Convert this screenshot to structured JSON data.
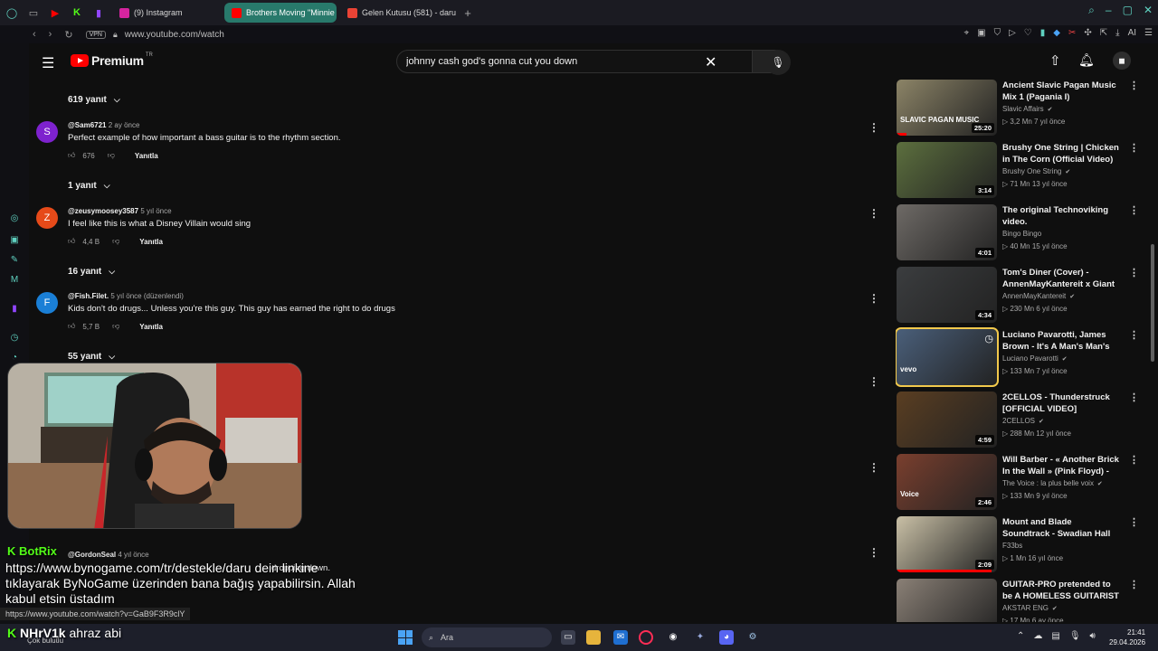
{
  "browser": {
    "tabs": [
      {
        "label": "(9) Instagram",
        "color": "#d6249f"
      },
      {
        "label": "Brothers Moving \"Minnie",
        "color": "#ff0000"
      },
      {
        "label": "Gelen Kutusu (581) - daru",
        "color": "#ea4335"
      }
    ],
    "new_tab": "+",
    "vpn": "VPN",
    "url": "www.youtube.com/watch",
    "accent": "#28796b"
  },
  "youtube": {
    "logo_text": "Premium",
    "logo_region": "TR",
    "search_value": "johnny cash god's gonna cut you down"
  },
  "comments": {
    "toggles": [
      {
        "label": "619 yanıt"
      },
      {
        "label": "1 yanıt"
      },
      {
        "label": "16 yanıt"
      },
      {
        "label": "55 yanıt"
      }
    ],
    "items": [
      {
        "initial": "S",
        "avatar_color": "#7e22ce",
        "author": "@Sam6721",
        "time": "2 ay önce",
        "text": "Perfect example of how important a bass guitar is to the rhythm section.",
        "likes": "676",
        "reply": "Yanıtla"
      },
      {
        "initial": "Z",
        "avatar_color": "#e64a19",
        "author": "@zeusymoosey3587",
        "time": "5 yıl önce",
        "text": "I feel like this is what a Disney Villain would sing",
        "likes": "4,4 B",
        "reply": "Yanıtla"
      },
      {
        "initial": "F",
        "avatar_color": "#1a7fd6",
        "author": "@Fish.Filet.",
        "time": "5 yıl önce (düzenlendi)",
        "text": "Kids don't do drugs... Unless you're this guy. This guy has earned the right to do drugs",
        "likes": "5,7 B",
        "reply": "Yanıtla"
      }
    ],
    "gordon_author": "@GordonSeal",
    "gordon_time": "4 yıl önce",
    "gordon_text_tail": "dropping down."
  },
  "sidebar": {
    "videos": [
      {
        "title": "Ancient Slavic Pagan Music Mix 1 (Pagania I)",
        "channel": "Slavic Affairs",
        "verified": true,
        "meta": "▷ 3,2 Mn   7 yıl önce",
        "duration": "25:20",
        "thumb_color": "#8c8467",
        "thumb_text": "SLAVIC PAGAN MUSIC",
        "progress": 0.1
      },
      {
        "title": "Brushy One String | Chicken in The Corn (Official Video)",
        "channel": "Brushy One String",
        "verified": true,
        "meta": "▷ 71 Mn   13 yıl önce",
        "duration": "3:14",
        "thumb_color": "#5c6f3e",
        "thumb_text": "",
        "progress": 0
      },
      {
        "title": "The original Technoviking video.",
        "channel": "Bingo Bingo",
        "verified": false,
        "meta": "▷ 40 Mn   15 yıl önce",
        "duration": "4:01",
        "thumb_color": "#6e6a66",
        "thumb_text": "",
        "progress": 0
      },
      {
        "title": "Tom's Diner (Cover) - AnnenMayKantereit x Giant ...",
        "channel": "AnnenMayKantereit",
        "verified": true,
        "meta": "▷ 230 Mn   6 yıl önce",
        "duration": "4:34",
        "thumb_color": "#3b3d3f",
        "thumb_text": "",
        "progress": 0
      },
      {
        "title": "Luciano Pavarotti, James Brown - It's A Man's Man's Man's Worl...",
        "channel": "Luciano Pavarotti",
        "verified": true,
        "meta": "▷ 133 Mn   7 yıl önce",
        "duration": "",
        "thumb_color": "#4a5f7a",
        "thumb_text": "vevo",
        "progress": 0
      },
      {
        "title": "2CELLOS - Thunderstruck [OFFICIAL VIDEO]",
        "channel": "2CELLOS",
        "verified": true,
        "meta": "▷ 288 Mn   12 yıl önce",
        "duration": "4:59",
        "thumb_color": "#5a3e22",
        "thumb_text": "",
        "progress": 0
      },
      {
        "title": "Will Barber - « Another Brick In the Wall » (Pink Floyd) - The ...",
        "channel": "The Voice : la plus belle voix",
        "verified": true,
        "meta": "▷ 133 Mn   9 yıl önce",
        "duration": "2:46",
        "thumb_color": "#7a3f2e",
        "thumb_text": "Voice",
        "progress": 0
      },
      {
        "title": "Mount and Blade Soundtrack - Swadian Hall",
        "channel": "F33bs",
        "verified": false,
        "meta": "▷ 1 Mn   16 yıl önce",
        "duration": "2:09",
        "thumb_color": "#c9c0a6",
        "thumb_text": "",
        "progress": 0.95
      },
      {
        "title": "GUITAR-PRO pretended to be A HOMELESS GUITARIST and ...",
        "channel": "AKSTAR ENG",
        "verified": true,
        "meta": "▷ 17 Mn   6 ay önce",
        "duration": "",
        "thumb_color": "#8a8076",
        "thumb_text": "",
        "progress": 0
      }
    ]
  },
  "overlay": {
    "bot_name": "BotRix",
    "bot_message": "https://www.bynogame.com/tr/destekle/daru dein linkine tıklayarak ByNoGame üzerinden bana bağış yapabilirsin. Allah kabul etsin üstadım",
    "chat_user": "NHrV1k",
    "chat_text": "ahraz abi",
    "status_url": "https://www.youtube.com/watch?v=GaB9F3R9clY"
  },
  "taskbar": {
    "weather": "Çok bulutlu",
    "search_placeholder": "Ara",
    "time": "21:41",
    "date": "29.04.2026"
  }
}
